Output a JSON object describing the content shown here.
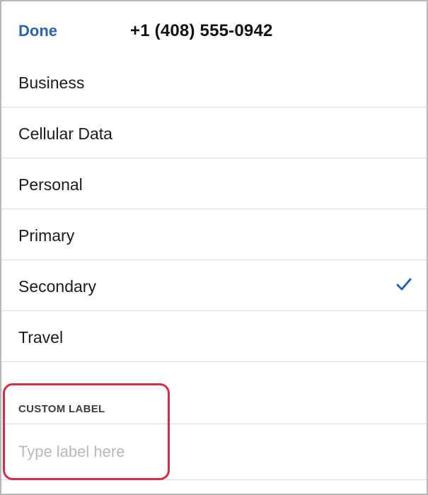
{
  "header": {
    "done_label": "Done",
    "title": "+1 (408) 555-0942"
  },
  "labels": [
    {
      "label": "Business",
      "selected": false
    },
    {
      "label": "Cellular Data",
      "selected": false
    },
    {
      "label": "Personal",
      "selected": false
    },
    {
      "label": "Primary",
      "selected": false
    },
    {
      "label": "Secondary",
      "selected": true
    },
    {
      "label": "Travel",
      "selected": false
    }
  ],
  "custom_label": {
    "section_title": "CUSTOM LABEL",
    "placeholder": "Type label here",
    "value": ""
  },
  "colors": {
    "accent": "#2c63ad",
    "highlight": "#d52d45"
  },
  "icons": {
    "selected": "checkmark-icon"
  }
}
